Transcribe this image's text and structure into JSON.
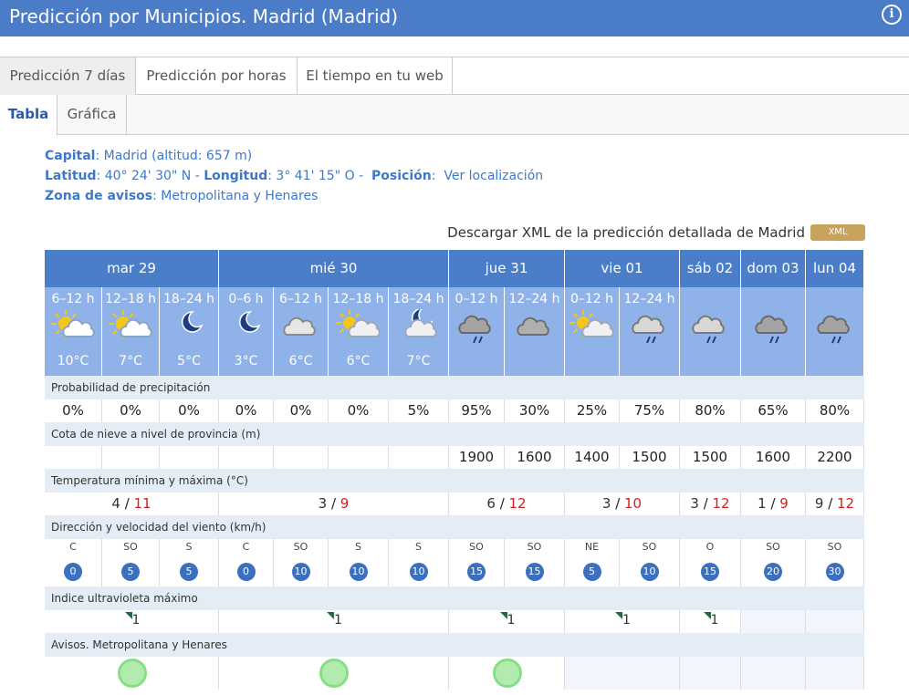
{
  "header": {
    "title": "Predicción por Municipios. Madrid (Madrid)",
    "info_icon": "info-icon"
  },
  "tabs": [
    {
      "label": "Predicción 7 días",
      "active": true
    },
    {
      "label": "Predicción por horas",
      "active": false
    },
    {
      "label": "El tiempo en tu web",
      "active": false
    }
  ],
  "subtabs": [
    {
      "label": "Tabla",
      "active": true
    },
    {
      "label": "Gráfica",
      "active": false
    }
  ],
  "info": {
    "capital_label": "Capital",
    "capital_value": "Madrid (altitud: 657 m)",
    "lat_label": "Latitud",
    "lat_value": "40° 24' 30\" N",
    "lon_label": "Longitud",
    "lon_value": "3° 41' 15\" O",
    "pos_label": "Posición",
    "pos_link": "Ver localización",
    "zona_label": "Zona de avisos",
    "zona_value": "Metropolitana y Henares"
  },
  "xml": {
    "text": "Descargar XML de la predicción detallada de Madrid",
    "badge": "XML"
  },
  "days": [
    {
      "label": "mar 29",
      "span": 3
    },
    {
      "label": "mié 30",
      "span": 4
    },
    {
      "label": "jue 31",
      "span": 2
    },
    {
      "label": "vie 01",
      "span": 2
    },
    {
      "label": "sáb 02",
      "span": 1
    },
    {
      "label": "dom 03",
      "span": 1
    },
    {
      "label": "lun 04",
      "span": 1
    }
  ],
  "periods": [
    {
      "period": "6–12 h",
      "icon": "sun-cloud",
      "temp": "10°C"
    },
    {
      "period": "12–18 h",
      "icon": "sun-cloud",
      "temp": "7°C"
    },
    {
      "period": "18–24 h",
      "icon": "moon",
      "temp": "5°C"
    },
    {
      "period": "0–6 h",
      "icon": "moon",
      "temp": "3°C"
    },
    {
      "period": "6–12 h",
      "icon": "cloud",
      "temp": "6°C"
    },
    {
      "period": "12–18 h",
      "icon": "sun-cloud-faint",
      "temp": "6°C"
    },
    {
      "period": "18–24 h",
      "icon": "moon-cloud",
      "temp": "7°C"
    },
    {
      "period": "0–12 h",
      "icon": "dark-cloud-rain",
      "temp": ""
    },
    {
      "period": "12–24 h",
      "icon": "dark-cloud",
      "temp": ""
    },
    {
      "period": "0–12 h",
      "icon": "sun-cloud-faint",
      "temp": ""
    },
    {
      "period": "12–24 h",
      "icon": "cloud-rain",
      "temp": ""
    },
    {
      "period": "",
      "icon": "cloud-rain",
      "temp": ""
    },
    {
      "period": "",
      "icon": "dark-cloud-rain",
      "temp": ""
    },
    {
      "period": "",
      "icon": "dark-cloud-rain",
      "temp": ""
    }
  ],
  "sections": {
    "precip": "Probabilidad de precipitación",
    "snow": "Cota de nieve a nivel de provincia (m)",
    "temps": "Temperatura mínima y máxima (°C)",
    "wind": "Dirección y velocidad del viento (km/h)",
    "uv": "Indice ultravioleta máximo",
    "avisos": "Avisos. Metropolitana y Henares"
  },
  "precip": [
    "0%",
    "0%",
    "0%",
    "0%",
    "0%",
    "0%",
    "5%",
    "95%",
    "30%",
    "25%",
    "75%",
    "80%",
    "65%",
    "80%"
  ],
  "snow": [
    "",
    "",
    "",
    "",
    "",
    "",
    "",
    "1900",
    "1600",
    "1400",
    "1500",
    "1500",
    "1600",
    "2200"
  ],
  "temps": [
    {
      "min": "4",
      "max": "11"
    },
    {
      "min": "3",
      "max": "9"
    },
    {
      "min": "6",
      "max": "12"
    },
    {
      "min": "3",
      "max": "10"
    },
    {
      "min": "3",
      "max": "12"
    },
    {
      "min": "1",
      "max": "9"
    },
    {
      "min": "9",
      "max": "12"
    }
  ],
  "wind": [
    {
      "dir": "C",
      "speed": "0"
    },
    {
      "dir": "SO",
      "speed": "5"
    },
    {
      "dir": "S",
      "speed": "5"
    },
    {
      "dir": "C",
      "speed": "0"
    },
    {
      "dir": "SO",
      "speed": "10"
    },
    {
      "dir": "S",
      "speed": "10"
    },
    {
      "dir": "S",
      "speed": "10"
    },
    {
      "dir": "SO",
      "speed": "15"
    },
    {
      "dir": "SO",
      "speed": "15"
    },
    {
      "dir": "NE",
      "speed": "5"
    },
    {
      "dir": "SO",
      "speed": "10"
    },
    {
      "dir": "O",
      "speed": "15"
    },
    {
      "dir": "SO",
      "speed": "20"
    },
    {
      "dir": "SO",
      "speed": "30"
    }
  ],
  "uv": [
    "1",
    "1",
    "1",
    "1",
    "1",
    "",
    ""
  ],
  "avisos": [
    true,
    true,
    true,
    false,
    false,
    false,
    false
  ],
  "colors": {
    "header_blue": "#4a7cc7",
    "day_blue": "#4b7ec8",
    "icon_blue": "#8fb2e8",
    "tmax_red": "#d22020",
    "aviso_green": "#86df84"
  }
}
